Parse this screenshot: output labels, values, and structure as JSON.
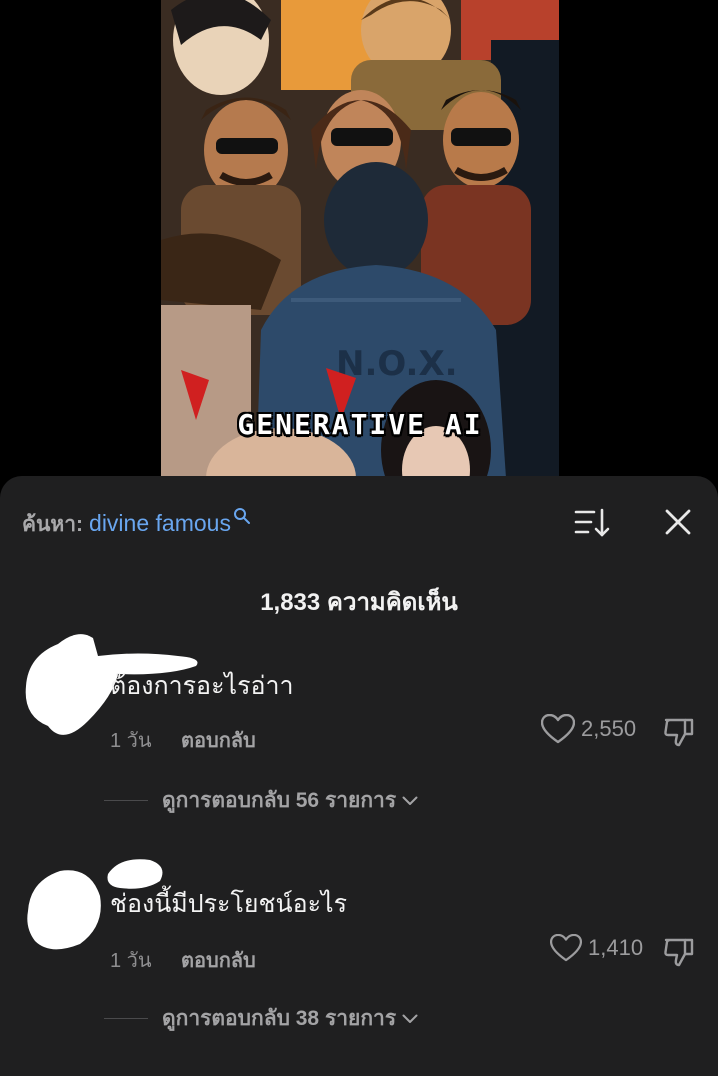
{
  "video": {
    "caption": "GENERATIVE AI"
  },
  "sheet": {
    "search_prefix": "ค้นหา:",
    "search_term": "divine famous",
    "comment_count_label": "1,833 ความคิดเห็น"
  },
  "comments": [
    {
      "text": "ต้องการอะไรอ่าา",
      "time": "1 วัน",
      "reply_label": "ตอบกลับ",
      "likes": "2,550",
      "view_replies": "ดูการตอบกลับ 56 รายการ"
    },
    {
      "text": "ช่องนี้มีประโยชน์อะไร",
      "time": "1 วัน",
      "reply_label": "ตอบกลับ",
      "likes": "1,410",
      "view_replies": "ดูการตอบกลับ 38 รายการ"
    }
  ],
  "colors": {
    "sheet_bg": "#1f1f20",
    "search_term": "#69a6ef",
    "muted_text": "#8e8e90"
  },
  "icons": [
    "search-icon",
    "sort-icon",
    "close-icon",
    "heart-icon",
    "dislike-icon",
    "chevron-down-icon"
  ]
}
